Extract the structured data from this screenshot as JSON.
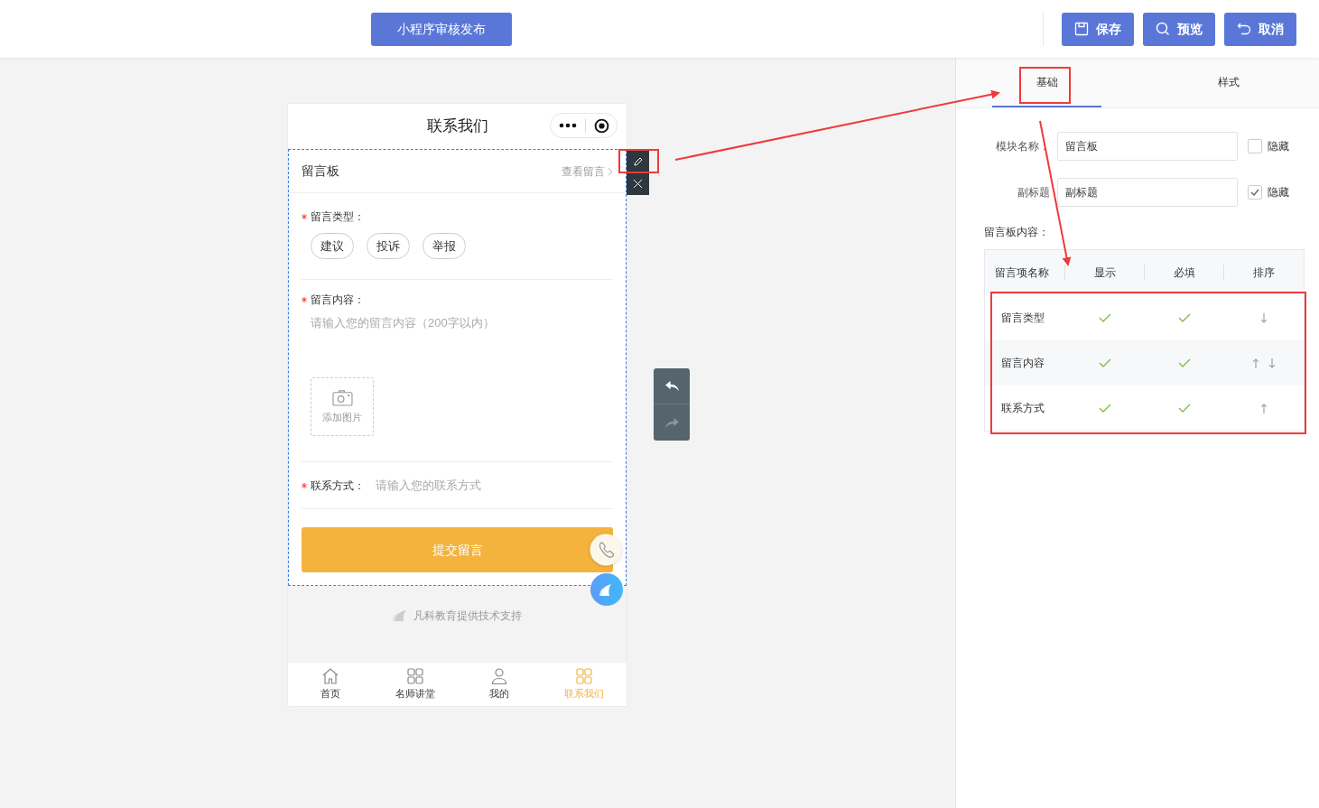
{
  "toolbar": {
    "publish_button": "小程序审核发布",
    "actions": [
      {
        "kind": "save",
        "label": "保存"
      },
      {
        "kind": "preview",
        "label": "预览"
      },
      {
        "kind": "cancel",
        "label": "取消"
      }
    ]
  },
  "phone": {
    "title": "联系我们",
    "module": {
      "title": "留言板",
      "link": "查看留言"
    },
    "fields": [
      {
        "kind": "choice",
        "label": "留言类型：",
        "required": true,
        "options": [
          "建议",
          "投诉",
          "举报"
        ]
      },
      {
        "kind": "textarea",
        "label": "留言内容：",
        "required": true,
        "placeholder": "请输入您的留言内容（200字以内）",
        "upload_label": "添加图片"
      },
      {
        "kind": "input",
        "label": "联系方式：",
        "required": true,
        "placeholder": "请输入您的联系方式"
      }
    ],
    "submit": "提交留言",
    "footer": "凡科教育提供技术支持",
    "tabbar": [
      {
        "kind": "home",
        "label": "首页",
        "selected": false
      },
      {
        "kind": "grid",
        "label": "名师讲堂",
        "selected": false
      },
      {
        "kind": "person",
        "label": "我的",
        "selected": false
      },
      {
        "kind": "grid",
        "label": "联系我们",
        "selected": true
      }
    ]
  },
  "panel": {
    "tabs": [
      {
        "label": "基础",
        "selected": true
      },
      {
        "label": "样式",
        "selected": false
      }
    ],
    "settings": [
      {
        "label": "模块名称：",
        "value": "留言板",
        "hide_label": "隐藏",
        "hidden": false
      },
      {
        "label": "副标题",
        "value": "副标题",
        "hide_label": "隐藏",
        "hidden": true
      }
    ],
    "content_label": "留言板内容：",
    "table": {
      "columns": [
        "留言项名称",
        "显示",
        "必填",
        "排序"
      ],
      "rows": [
        {
          "name": "留言类型",
          "shown": true,
          "required": true,
          "move_up": false,
          "move_down": true
        },
        {
          "name": "留言内容",
          "shown": true,
          "required": true,
          "move_up": true,
          "move_down": true
        },
        {
          "name": "联系方式",
          "shown": true,
          "required": true,
          "move_up": true,
          "move_down": false
        }
      ]
    }
  }
}
